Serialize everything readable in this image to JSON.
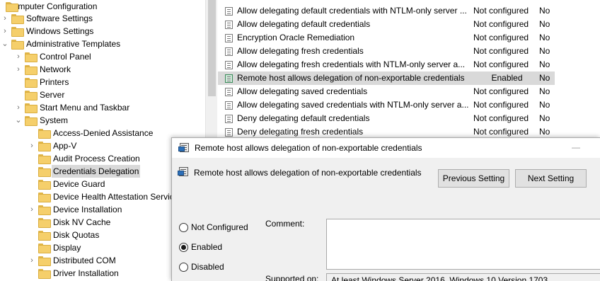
{
  "tree": {
    "items": [
      {
        "label": "Computer Configuration",
        "chevron": "",
        "folder": false
      },
      {
        "label": "Software Settings",
        "chevron": "collapsed",
        "folder": true
      },
      {
        "label": "Windows Settings",
        "chevron": "collapsed",
        "folder": true
      },
      {
        "label": "Administrative Templates",
        "chevron": "expanded",
        "folder": true
      },
      {
        "label": "Control Panel",
        "chevron": "collapsed",
        "folder": true
      },
      {
        "label": "Network",
        "chevron": "collapsed",
        "folder": true
      },
      {
        "label": "Printers",
        "chevron": "",
        "folder": true
      },
      {
        "label": "Server",
        "chevron": "",
        "folder": true
      },
      {
        "label": "Start Menu and Taskbar",
        "chevron": "collapsed",
        "folder": true
      },
      {
        "label": "System",
        "chevron": "expanded",
        "folder": true
      },
      {
        "label": "Access-Denied Assistance",
        "chevron": "",
        "folder": true
      },
      {
        "label": "App-V",
        "chevron": "collapsed",
        "folder": true
      },
      {
        "label": "Audit Process Creation",
        "chevron": "",
        "folder": true
      },
      {
        "label": "Credentials Delegation",
        "chevron": "",
        "folder": true,
        "selected": true
      },
      {
        "label": "Device Guard",
        "chevron": "",
        "folder": true
      },
      {
        "label": "Device Health Attestation Servic",
        "chevron": "",
        "folder": true
      },
      {
        "label": "Device Installation",
        "chevron": "collapsed",
        "folder": true
      },
      {
        "label": "Disk NV Cache",
        "chevron": "",
        "folder": true
      },
      {
        "label": "Disk Quotas",
        "chevron": "",
        "folder": true
      },
      {
        "label": "Display",
        "chevron": "",
        "folder": true
      },
      {
        "label": "Distributed COM",
        "chevron": "collapsed",
        "folder": true
      },
      {
        "label": "Driver Installation",
        "chevron": "",
        "folder": true
      }
    ]
  },
  "policies": [
    {
      "name": "Allow delegating default credentials with NTLM-only server ...",
      "state": "Not configured",
      "comment": "No"
    },
    {
      "name": "Allow delegating default credentials",
      "state": "Not configured",
      "comment": "No"
    },
    {
      "name": "Encryption Oracle Remediation",
      "state": "Not configured",
      "comment": "No"
    },
    {
      "name": "Allow delegating fresh credentials",
      "state": "Not configured",
      "comment": "No"
    },
    {
      "name": "Allow delegating fresh credentials with NTLM-only server a...",
      "state": "Not configured",
      "comment": "No"
    },
    {
      "name": "Remote host allows delegation of non-exportable credentials",
      "state": "Enabled",
      "comment": "No",
      "selected": true
    },
    {
      "name": "Allow delegating saved credentials",
      "state": "Not configured",
      "comment": "No"
    },
    {
      "name": "Allow delegating saved credentials with NTLM-only server a...",
      "state": "Not configured",
      "comment": "No"
    },
    {
      "name": "Deny delegating default credentials",
      "state": "Not configured",
      "comment": "No"
    },
    {
      "name": "Deny delegating fresh credentials",
      "state": "Not configured",
      "comment": "No"
    }
  ],
  "dialog": {
    "title": "Remote host allows delegation of non-exportable credentials",
    "minimize_glyph": "—",
    "setting_title": "Remote host allows delegation of non-exportable credentials",
    "previous_label": "Previous Setting",
    "next_label": "Next Setting",
    "options": {
      "not_configured": "Not Configured",
      "enabled": "Enabled",
      "disabled": "Disabled",
      "selected": "enabled"
    },
    "comment_label": "Comment:",
    "comment_value": "",
    "supported_label": "Supported on:",
    "supported_value": "At least Windows Server 2016, Windows 10 Version 1703"
  },
  "colors": {
    "selection": "#d9d9d9",
    "dialog_body": "#f0f0f0",
    "button_face": "#e1e1e1",
    "folder": "#f5cf6b"
  },
  "icons": {
    "tree_folder": "folder-icon",
    "policy": "policy-setting-icon",
    "chevron_collapsed": "chevron-right-icon",
    "chevron_expanded": "chevron-down-icon"
  }
}
